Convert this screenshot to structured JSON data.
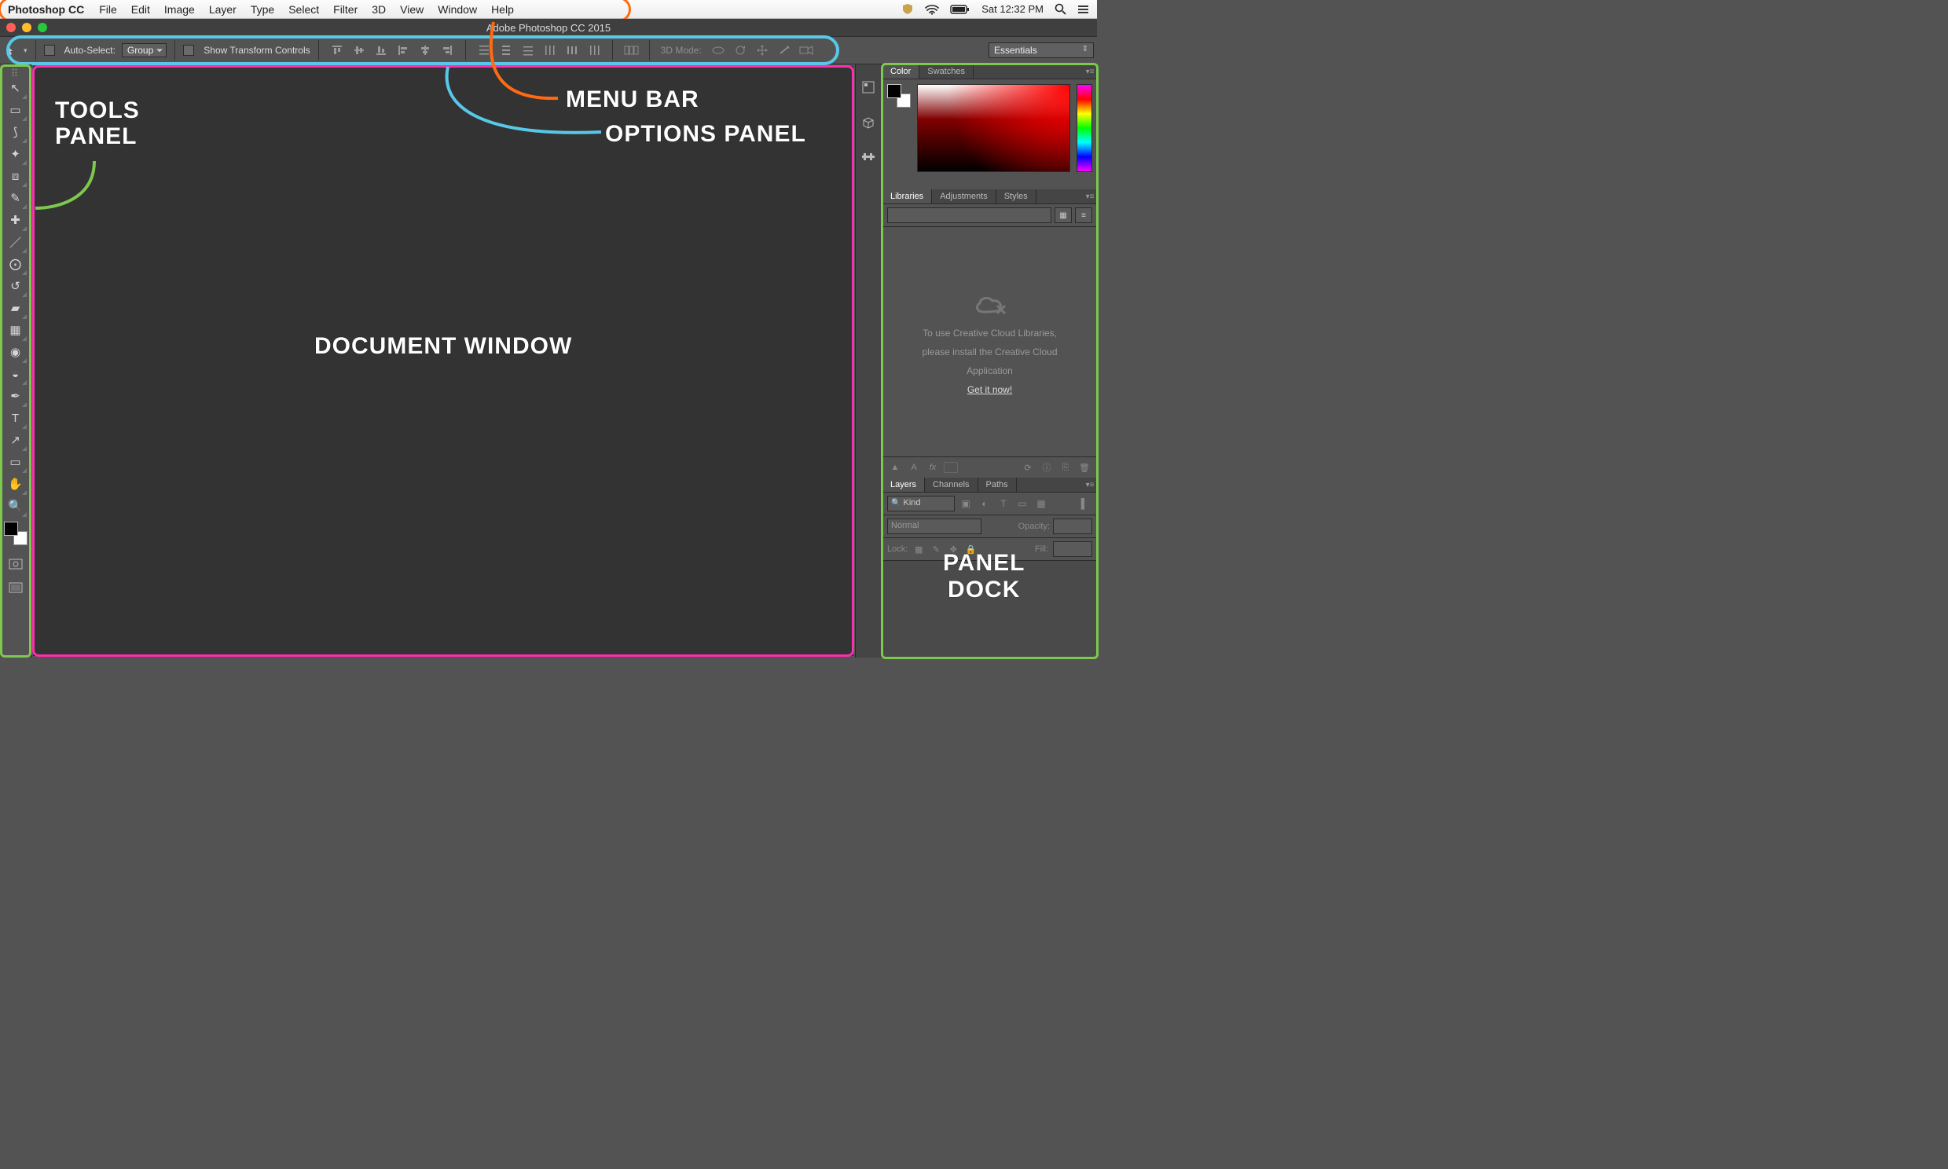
{
  "system": {
    "clock": "Sat 12:32 PM"
  },
  "menubar": {
    "app_name": "Photoshop CC",
    "items": [
      "File",
      "Edit",
      "Image",
      "Layer",
      "Type",
      "Select",
      "Filter",
      "3D",
      "View",
      "Window",
      "Help"
    ]
  },
  "window": {
    "title": "Adobe Photoshop CC 2015"
  },
  "options_bar": {
    "auto_select_label": "Auto-Select:",
    "auto_select_mode": "Group",
    "show_transform_label": "Show Transform Controls",
    "mode_3d_label": "3D Mode:",
    "workspace_selected": "Essentials",
    "align_group": [
      "align-top",
      "align-vmid",
      "align-bottom",
      "align-left",
      "align-hmid",
      "align-right"
    ],
    "distribute_group": [
      "dist-top",
      "dist-vmid",
      "dist-bottom",
      "dist-left",
      "dist-hmid",
      "dist-right"
    ],
    "arrange_button": "auto-align",
    "mode_3d_buttons": [
      "orbit",
      "roll",
      "pan",
      "slide",
      "zoom"
    ]
  },
  "tools": {
    "list": [
      {
        "name": "move-tool",
        "glyph": "↖"
      },
      {
        "name": "marquee-tool",
        "glyph": "▭"
      },
      {
        "name": "lasso-tool",
        "glyph": "⟆"
      },
      {
        "name": "quick-select-tool",
        "glyph": "✦"
      },
      {
        "name": "crop-tool",
        "glyph": "⧈"
      },
      {
        "name": "eyedropper-tool",
        "glyph": "✎"
      },
      {
        "name": "spot-heal-tool",
        "glyph": "✚"
      },
      {
        "name": "brush-tool",
        "glyph": "／"
      },
      {
        "name": "clone-stamp-tool",
        "glyph": "⨀"
      },
      {
        "name": "history-brush-tool",
        "glyph": "↺"
      },
      {
        "name": "eraser-tool",
        "glyph": "▰"
      },
      {
        "name": "gradient-tool",
        "glyph": "▦"
      },
      {
        "name": "blur-tool",
        "glyph": "◉"
      },
      {
        "name": "dodge-tool",
        "glyph": "◒"
      },
      {
        "name": "pen-tool",
        "glyph": "✒"
      },
      {
        "name": "type-tool",
        "glyph": "T"
      },
      {
        "name": "path-select-tool",
        "glyph": "↗"
      },
      {
        "name": "shape-tool",
        "glyph": "▭"
      },
      {
        "name": "hand-tool",
        "glyph": "✋"
      },
      {
        "name": "zoom-tool",
        "glyph": "🔍"
      }
    ]
  },
  "panels": {
    "collapsed_group": [
      "history-icon",
      "3d-icon",
      "properties-icon"
    ],
    "color": {
      "tabs": [
        "Color",
        "Swatches"
      ],
      "active": 0
    },
    "libraries": {
      "tabs": [
        "Libraries",
        "Adjustments",
        "Styles"
      ],
      "active": 0,
      "message_line1": "To use Creative Cloud Libraries,",
      "message_line2": "please install the Creative Cloud",
      "message_line3": "Application",
      "get_link": "Get it now!"
    },
    "layers": {
      "tabs": [
        "Layers",
        "Channels",
        "Paths"
      ],
      "active": 0,
      "filter_kind_label": "Kind",
      "blend_mode": "Normal",
      "opacity_label": "Opacity:",
      "lock_label": "Lock:",
      "fill_label": "Fill:"
    }
  },
  "annotations": {
    "tools_label_1": "TOOLS",
    "tools_label_2": "PANEL",
    "doc_label": "DOCUMENT WINDOW",
    "menu_label": "MENU BAR",
    "options_label": "OPTIONS PANEL",
    "dock_label_1": "PANEL",
    "dock_label_2": "DOCK"
  }
}
